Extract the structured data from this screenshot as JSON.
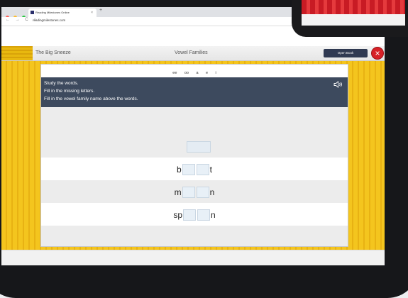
{
  "browser": {
    "tab_title": "Reading Milestones Online",
    "tab_close": "×",
    "new_tab": "+",
    "nav_buttons": "← → C ⌂",
    "url": "readingmilestones.com"
  },
  "header": {
    "book_title": "The Big Sneeze",
    "section_title": "Vowel Families",
    "open_book_label": "Open Book",
    "close_icon": "close-icon"
  },
  "vowels": [
    "ee",
    "oo",
    "a",
    "e",
    "i"
  ],
  "instructions": {
    "lines": [
      "Study the words.",
      "Fill in the missing letters.",
      "Fill in the vowel family name above the words."
    ],
    "speaker_icon": "speaker-icon"
  },
  "words": [
    {
      "prefix": "b",
      "suffix": "t"
    },
    {
      "prefix": "m",
      "suffix": "n"
    },
    {
      "prefix": "sp",
      "suffix": "n"
    }
  ],
  "colors": {
    "yellow": "#f4c51e",
    "instruction_bar": "#3d4a5e",
    "close_red": "#d72127",
    "open_book_button": "#303a52"
  }
}
